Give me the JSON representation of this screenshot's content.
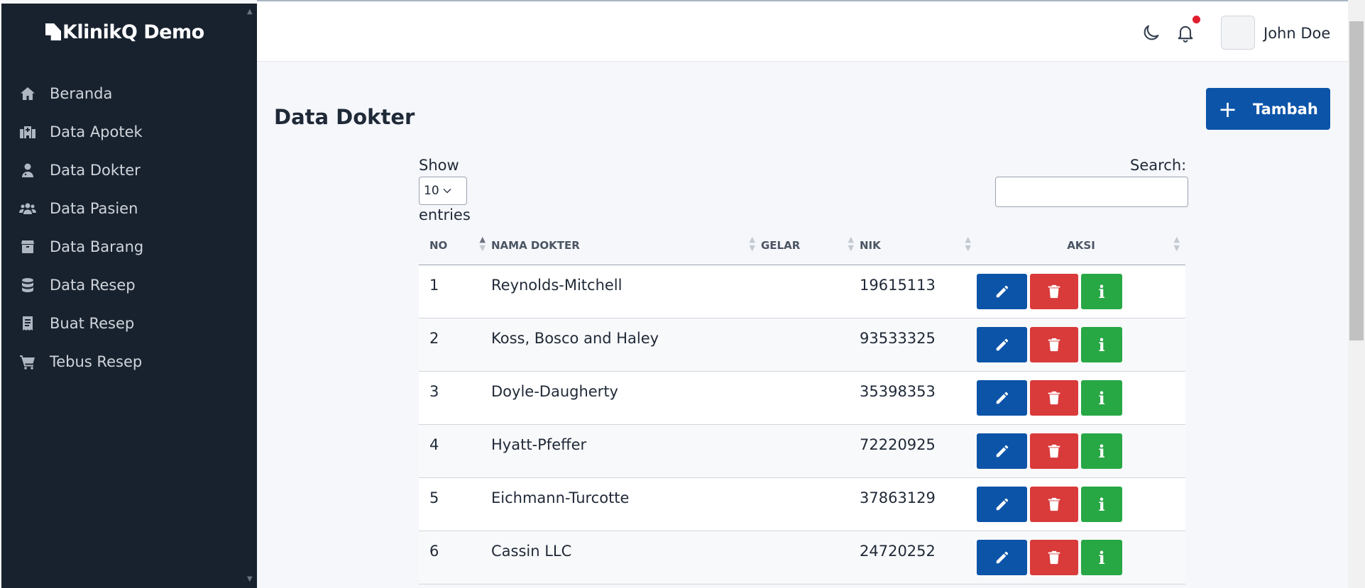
{
  "app": {
    "title": "KlinikQ Demo"
  },
  "sidebar": {
    "items": [
      {
        "label": "Beranda",
        "icon": "home-icon"
      },
      {
        "label": "Data Apotek",
        "icon": "hospital-icon"
      },
      {
        "label": "Data Dokter",
        "icon": "doctor-icon"
      },
      {
        "label": "Data Pasien",
        "icon": "users-icon"
      },
      {
        "label": "Data Barang",
        "icon": "box-icon"
      },
      {
        "label": "Data Resep",
        "icon": "database-icon"
      },
      {
        "label": "Buat Resep",
        "icon": "receipt-icon"
      },
      {
        "label": "Tebus Resep",
        "icon": "cart-icon"
      }
    ]
  },
  "header": {
    "user_name": "John Doe"
  },
  "main": {
    "title": "Data Dokter",
    "add_label": "Tambah",
    "show_label": "Show",
    "entries_value": "10",
    "entries_label": "entries",
    "search_label": "Search:",
    "search_value": ""
  },
  "table": {
    "columns": [
      "NO",
      "NAMA DOKTER",
      "GELAR",
      "NIK",
      "AKSI"
    ],
    "rows": [
      {
        "no": "1",
        "nama": "Reynolds-Mitchell",
        "gelar": "",
        "nik": "19615113"
      },
      {
        "no": "2",
        "nama": "Koss, Bosco and Haley",
        "gelar": "",
        "nik": "93533325"
      },
      {
        "no": "3",
        "nama": "Doyle-Daugherty",
        "gelar": "",
        "nik": "35398353"
      },
      {
        "no": "4",
        "nama": "Hyatt-Pfeffer",
        "gelar": "",
        "nik": "72220925"
      },
      {
        "no": "5",
        "nama": "Eichmann-Turcotte",
        "gelar": "",
        "nik": "37863129"
      },
      {
        "no": "6",
        "nama": "Cassin LLC",
        "gelar": "",
        "nik": "24720252"
      }
    ],
    "info_label": "i"
  },
  "colors": {
    "sidebar_bg": "#18222f",
    "primary": "#0b54a8",
    "danger": "#d93a3a",
    "success": "#28a745",
    "notification_dot": "#e11d2e"
  }
}
